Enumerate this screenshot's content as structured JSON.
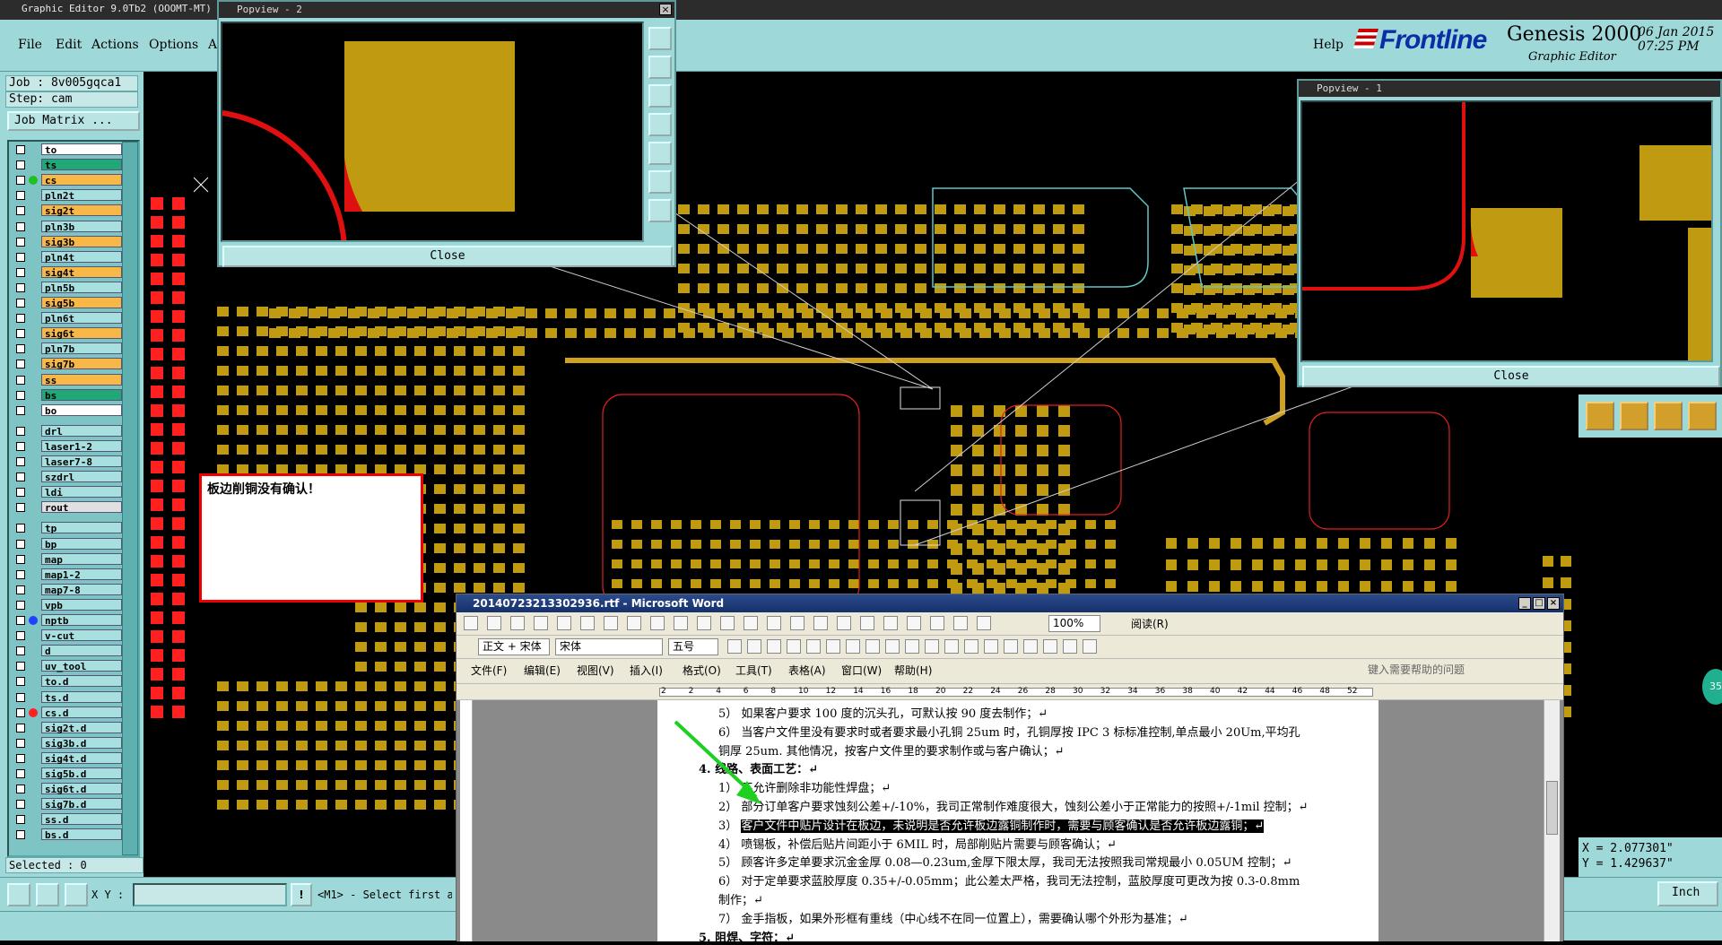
{
  "genesis": {
    "title": "Graphic Editor 9.0Tb2 (OOOMT-MT)",
    "menu": [
      "File",
      "Edit",
      "Actions",
      "Options",
      "A"
    ],
    "help_label": "Help",
    "brand": {
      "logo": "Frontline",
      "product": "Genesis 2000",
      "subtitle": "Graphic Editor",
      "date": "06 Jan 2015",
      "time": "07:25 PM"
    },
    "job": "Job : 8v005gqca1",
    "step": "Step: cam",
    "matrix_button": "Job Matrix ...",
    "layers": [
      {
        "name": "to",
        "color": "#ffffff",
        "dot": ""
      },
      {
        "name": "ts",
        "color": "#20a878",
        "dot": ""
      },
      {
        "name": "cs",
        "color": "#f8b848",
        "dot": "#20c020"
      },
      {
        "name": "pln2t",
        "color": "#a8e0e0",
        "dot": ""
      },
      {
        "name": "sig2t",
        "color": "#f8b848",
        "dot": ""
      },
      {
        "name": "pln3b",
        "color": "#a8e0e0",
        "dot": ""
      },
      {
        "name": "sig3b",
        "color": "#f8b848",
        "dot": ""
      },
      {
        "name": "pln4t",
        "color": "#a8e0e0",
        "dot": ""
      },
      {
        "name": "sig4t",
        "color": "#f8b848",
        "dot": ""
      },
      {
        "name": "pln5b",
        "color": "#a8e0e0",
        "dot": ""
      },
      {
        "name": "sig5b",
        "color": "#f8b848",
        "dot": ""
      },
      {
        "name": "pln6t",
        "color": "#a8e0e0",
        "dot": ""
      },
      {
        "name": "sig6t",
        "color": "#f8b848",
        "dot": ""
      },
      {
        "name": "pln7b",
        "color": "#a8e0e0",
        "dot": ""
      },
      {
        "name": "sig7b",
        "color": "#f8b848",
        "dot": ""
      },
      {
        "name": "ss",
        "color": "#f8b848",
        "dot": ""
      },
      {
        "name": "bs",
        "color": "#20a878",
        "dot": ""
      },
      {
        "name": "bo",
        "color": "#ffffff",
        "dot": ""
      },
      {
        "name": "drl",
        "color": "#a8e0e0",
        "dot": ""
      },
      {
        "name": "laser1-2",
        "color": "#a8e0e0",
        "dot": ""
      },
      {
        "name": "laser7-8",
        "color": "#a8e0e0",
        "dot": ""
      },
      {
        "name": "szdrl",
        "color": "#a8e0e0",
        "dot": ""
      },
      {
        "name": "ldi",
        "color": "#a8e0e0",
        "dot": ""
      },
      {
        "name": "rout",
        "color": "#e0e0e0",
        "dot": ""
      },
      {
        "name": "tp",
        "color": "#a8e0e0",
        "dot": ""
      },
      {
        "name": "bp",
        "color": "#a8e0e0",
        "dot": ""
      },
      {
        "name": "map",
        "color": "#a8e0e0",
        "dot": ""
      },
      {
        "name": "map1-2",
        "color": "#a8e0e0",
        "dot": ""
      },
      {
        "name": "map7-8",
        "color": "#a8e0e0",
        "dot": ""
      },
      {
        "name": "vpb",
        "color": "#a8e0e0",
        "dot": ""
      },
      {
        "name": "nptb",
        "color": "#a8e0e0",
        "dot": "#2040ff"
      },
      {
        "name": "v-cut",
        "color": "#a8e0e0",
        "dot": ""
      },
      {
        "name": "d",
        "color": "#a8e0e0",
        "dot": ""
      },
      {
        "name": "uv_tool",
        "color": "#a8e0e0",
        "dot": ""
      },
      {
        "name": "to.d",
        "color": "#a8e0e0",
        "dot": ""
      },
      {
        "name": "ts.d",
        "color": "#a8e0e0",
        "dot": ""
      },
      {
        "name": "cs.d",
        "color": "#a8e0e0",
        "dot": "#ff2020"
      },
      {
        "name": "sig2t.d",
        "color": "#a8e0e0",
        "dot": ""
      },
      {
        "name": "sig3b.d",
        "color": "#a8e0e0",
        "dot": ""
      },
      {
        "name": "sig4t.d",
        "color": "#a8e0e0",
        "dot": ""
      },
      {
        "name": "sig5b.d",
        "color": "#a8e0e0",
        "dot": ""
      },
      {
        "name": "sig6t.d",
        "color": "#a8e0e0",
        "dot": ""
      },
      {
        "name": "sig7b.d",
        "color": "#a8e0e0",
        "dot": ""
      },
      {
        "name": "ss.d",
        "color": "#a8e0e0",
        "dot": ""
      },
      {
        "name": "bs.d",
        "color": "#a8e0e0",
        "dot": ""
      }
    ],
    "selected": "Selected : 0",
    "xy_label": "X Y :",
    "prompt_button": "!",
    "prompt": "<M1> - Select first a",
    "units": "Inch",
    "coord_x": "X = 2.077301\"",
    "coord_y": "Y = 1.429637\"",
    "badge": "35",
    "colors": {
      "pad": "#c09a10",
      "board": "#000000",
      "panel": "#9fd8d8",
      "outline": "#e02020"
    }
  },
  "popview2": {
    "title": "Popview - 2",
    "close": "Close"
  },
  "popview1": {
    "title": "Popview - 1",
    "close": "Close"
  },
  "warning": "板边削铜没有确认！",
  "word": {
    "title": "20140723213302936.rtf - Microsoft Word",
    "style": "正文 + 宋体",
    "font": "宋体",
    "size": "五号",
    "zoom": "100%",
    "read_label": "阅读(R)",
    "menus": [
      "文件(F)",
      "编辑(E)",
      "视图(V)",
      "插入(I)",
      "格式(O)",
      "工具(T)",
      "表格(A)",
      "窗口(W)",
      "帮助(H)"
    ],
    "help_placeholder": "键入需要帮助的问题",
    "ruler_marks": [
      "2",
      "2",
      "4",
      "6",
      "8",
      "10",
      "12",
      "14",
      "16",
      "18",
      "20",
      "22",
      "24",
      "26",
      "28",
      "30",
      "32",
      "34",
      "36",
      "38",
      "40",
      "42",
      "44",
      "46",
      "48",
      "52"
    ],
    "lines": [
      "5） 如果客户要求 100 度的沉头孔，可默认按 90 度去制作；↵",
      "6） 当客户文件里没有要求时或者要求最小孔铜 25um 时，孔铜厚按 IPC 3 标标准控制,单点最小 20Um,平均孔",
      "    铜厚 25um. 其他情况，按客户文件里的要求制作或与客户确认；↵",
      "4.  线路、表面工艺：↵",
      "1） 不允许删除非功能性焊盘；↵",
      "2） 部分订单客户要求蚀刻公差+/-10%，我司正常制作难度很大，蚀刻公差小于正常能力的按照+/-1mil 控制；↵",
      "3） 客户文件中贴片设计在板边，未说明是否允许板边露铜制作时，需要与顾客确认是否允许板边露铜；↵",
      "4） 喷锡板，补偿后贴片间距小于 6MIL 时，局部削贴片需要与顾客确认；↵",
      "5） 顾客许多定单要求沉金金厚 0.08—0.23um,金厚下限太厚，我司无法按照我司常规最小 0.05UM 控制；↵",
      "6） 对于定单要求蓝胶厚度 0.35+/-0.05mm；此公差太严格，我司无法控制，蓝胶厚度可更改为按 0.3-0.8mm",
      "    制作；↵",
      "7） 金手指板，如果外形框有重线（中心线不在同一位置上），需要确认哪个外形为基准；↵",
      "5.  阻焊、字符：↵"
    ]
  }
}
